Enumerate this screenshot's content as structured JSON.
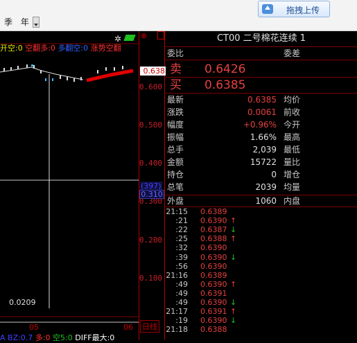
{
  "topbar": {
    "period_tabs": [
      "季",
      "年"
    ],
    "upload_button": "拖拽上传"
  },
  "chart": {
    "legend": [
      {
        "text": "开空:0",
        "color": "#e6e600"
      },
      {
        "text": "空翻多:0",
        "color": "#ff3030"
      },
      {
        "text": "多翻空:0",
        "color": "#3060ff"
      },
      {
        "text": "涨势空翻",
        "color": "#ff3030"
      }
    ],
    "low_label": "0.0209",
    "x_labels": [
      "05",
      "06"
    ],
    "bottom_legend": [
      {
        "text": "A BZ:0.7",
        "color": "#4040ff"
      },
      {
        "text": "多:0",
        "color": "#ff3030"
      },
      {
        "text": "空5:0",
        "color": "#20c020"
      },
      {
        "text": "DIFF最大:0",
        "color": "#ffffff"
      }
    ]
  },
  "axis": {
    "ticks": [
      "0.600",
      "0.500",
      "0.400",
      "0.300",
      "0.200",
      "0.100"
    ],
    "price_tag": "0.638",
    "volume_tag": "(397)",
    "current_tag": "0.310",
    "daily_tab": "日线"
  },
  "quote": {
    "title": "CT00  二号棉花连续  1",
    "weibi_label": "委比",
    "weicha_label": "委差",
    "sell_label": "卖",
    "sell_price": "0.6426",
    "buy_label": "买",
    "buy_price": "0.6385",
    "rows": [
      {
        "l1": "最新",
        "v1": "0.6385",
        "c1": "red",
        "l2": "均价"
      },
      {
        "l1": "涨跌",
        "v1": "0.0061",
        "c1": "red",
        "l2": "前收"
      },
      {
        "l1": "幅度",
        "v1": "+0.96%",
        "c1": "red",
        "l2": "今开"
      },
      {
        "l1": "振幅",
        "v1": "1.66%",
        "c1": "white",
        "l2": "最高"
      },
      {
        "l1": "总手",
        "v1": "2,039",
        "c1": "white",
        "l2": "最低"
      },
      {
        "l1": "金额",
        "v1": "15722",
        "c1": "white",
        "l2": "量比"
      },
      {
        "l1": "持仓",
        "v1": "0",
        "c1": "white",
        "l2": "增仓"
      },
      {
        "l1": "总笔",
        "v1": "2039",
        "c1": "white",
        "l2": "均量"
      }
    ],
    "outer_label": "外盘",
    "outer_value": "1060",
    "inner_label": "内盘"
  },
  "ticks": [
    {
      "time": "21:15",
      "price": "0.6389",
      "arrow": ""
    },
    {
      "time": ":21",
      "price": "0.6390",
      "arrow": "↑"
    },
    {
      "time": ":22",
      "price": "0.6387",
      "arrow": "↓"
    },
    {
      "time": ":25",
      "price": "0.6388",
      "arrow": "↑"
    },
    {
      "time": ":32",
      "price": "0.6390",
      "arrow": ""
    },
    {
      "time": ":39",
      "price": "0.6390",
      "arrow": "↓"
    },
    {
      "time": ":56",
      "price": "0.6390",
      "arrow": ""
    },
    {
      "time": "21:16",
      "price": "0.6389",
      "arrow": ""
    },
    {
      "time": ":49",
      "price": "0.6390",
      "arrow": "↑"
    },
    {
      "time": ":49",
      "price": "0.6391",
      "arrow": ""
    },
    {
      "time": ":49",
      "price": "0.6390",
      "arrow": "↓"
    },
    {
      "time": "21:17",
      "price": "0.6391",
      "arrow": "↑"
    },
    {
      "time": ":19",
      "price": "0.6390",
      "arrow": "↓"
    },
    {
      "time": "21:18",
      "price": "0.6388",
      "arrow": ""
    }
  ]
}
